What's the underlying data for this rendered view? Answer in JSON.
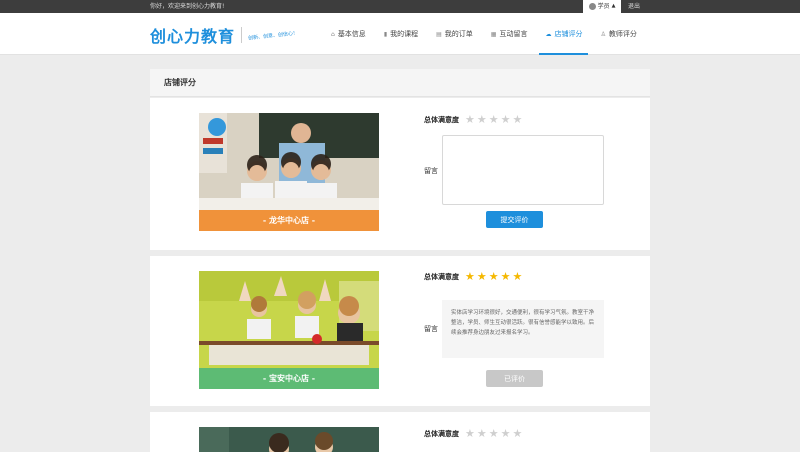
{
  "topbar": {
    "welcome": "你好，欢迎来到创心力教育!",
    "user": "学员",
    "logout": "退出"
  },
  "header": {
    "logo": "创心力教育",
    "slogan": "创新、创意、创信心！",
    "nav": [
      {
        "label": "基本信息",
        "icon": "home-icon",
        "active": false
      },
      {
        "label": "我的课程",
        "icon": "chart-icon",
        "active": false
      },
      {
        "label": "我的订单",
        "icon": "list-icon",
        "active": false
      },
      {
        "label": "互动留言",
        "icon": "grid-icon",
        "active": false
      },
      {
        "label": "店铺评分",
        "icon": "shop-icon",
        "active": true
      },
      {
        "label": "教师评分",
        "icon": "person-icon",
        "active": false
      }
    ]
  },
  "panel": {
    "title": "店铺评分"
  },
  "colors": {
    "accent": "#1e8fdc",
    "orange": "#f0923a",
    "green": "#5dbb74",
    "star_on": "#f5b800"
  },
  "stores": [
    {
      "name": "- 龙华中心店 -",
      "label_color": "#f0923a",
      "rating_label": "总体满意度",
      "stars": 0,
      "message_label": "留言",
      "message": "",
      "button": "提交评价",
      "button_state": "primary"
    },
    {
      "name": "- 宝安中心店 -",
      "label_color": "#5dbb74",
      "rating_label": "总体满意度",
      "stars": 5,
      "message_label": "留言",
      "message": "实体店学习环境很好，交通便利，很有学习气氛。教室干净整洁，学员、师生互动很活跃。很有信誉感能学以致用。后续会推荐身边朋友过来报名学习。",
      "button": "已评价",
      "button_state": "disabled"
    },
    {
      "name": "",
      "rating_label": "总体满意度",
      "stars": 0
    }
  ]
}
